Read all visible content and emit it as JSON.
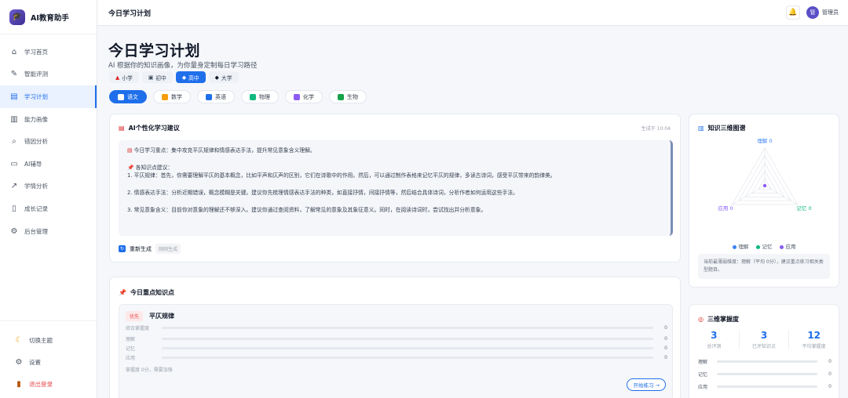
{
  "brand": {
    "name": "AI教育助手",
    "logo_icon": "graduation-cap-icon"
  },
  "sidebar": {
    "items": [
      {
        "label": "学习首页",
        "icon": "home-icon",
        "glyph": "⌂",
        "active": false
      },
      {
        "label": "智能评测",
        "icon": "edit-note-icon",
        "glyph": "✎",
        "active": false
      },
      {
        "label": "学习计划",
        "icon": "calendar-icon",
        "glyph": "▤",
        "active": true
      },
      {
        "label": "能力画像",
        "icon": "bar-chart-icon",
        "glyph": "▥",
        "active": false
      },
      {
        "label": "错因分析",
        "icon": "magnifier-icon",
        "glyph": "⌕",
        "active": false
      },
      {
        "label": "AI辅导",
        "icon": "chat-icon",
        "glyph": "▭",
        "active": false
      },
      {
        "label": "学情分析",
        "icon": "trend-chart-icon",
        "glyph": "↗",
        "active": false
      },
      {
        "label": "成长记录",
        "icon": "notebook-icon",
        "glyph": "▯",
        "active": false
      },
      {
        "label": "后台管理",
        "icon": "gear-icon",
        "glyph": "⚙",
        "active": false
      }
    ],
    "bottom": [
      {
        "label": "切换主题",
        "icon": "moon-icon",
        "glyph": "☾"
      },
      {
        "label": "设置",
        "icon": "gear-icon",
        "glyph": "⚙"
      },
      {
        "label": "退出登录",
        "icon": "door-icon",
        "glyph": "▮"
      }
    ]
  },
  "topbar": {
    "title": "今日学习计划",
    "user_name": "管理员",
    "avatar_text": "管"
  },
  "header": {
    "title": "今日学习计划",
    "subtitle": "AI 根据你的知识画像，为你量身定制每日学习路径",
    "levels": [
      {
        "label": "小学",
        "glyph": "▲",
        "active": false
      },
      {
        "label": "初中",
        "glyph": "▣",
        "active": false
      },
      {
        "label": "高中",
        "glyph": "◆",
        "active": true
      },
      {
        "label": "大学",
        "glyph": "◆",
        "active": false
      }
    ],
    "subjects": [
      {
        "label": "语文",
        "color": "#ffffff",
        "active": true
      },
      {
        "label": "数学",
        "color": "#f59e0b",
        "active": false
      },
      {
        "label": "英语",
        "color": "#1f6feb",
        "active": false
      },
      {
        "label": "物理",
        "color": "#10b981",
        "active": false
      },
      {
        "label": "化学",
        "color": "#8b5cf6",
        "active": false
      },
      {
        "label": "生物",
        "color": "#16a34a",
        "active": false
      }
    ]
  },
  "ai_card": {
    "title": "AI个性化学习建议",
    "generated_at": "生成于 10:04",
    "focus": "今日学习重点：集中攻克平仄规律和情感表达手法，提升常见意象含义理解。",
    "tips_title": "各知识点建议：",
    "tip_1": "1. 平仄规律：首先，你需要理解平仄的基本概念，比如平声和仄声的区别，它们在诗歌中的作用。然后，可以通过制作表格来记忆平仄的规律，多读古诗词，感受平仄带来的韵律美。",
    "tip_2": "2. 情感表达手法：分析近期错误，概念模糊是关键。建议你先梳理情感表达手法的种类，如直接抒情，间接抒情等，然后结合具体诗词，分析作者如何运用这些手法。",
    "tip_3": "3. 常见意象含义：目前你对意象的理解还不够深入。建议你通过查阅资料，了解常见的意象及其象征意义。同时，在阅读诗词时，尝试找出并分析意象。",
    "regen_label": "重新生成",
    "regen_tag": "刚刚生成"
  },
  "kp_card": {
    "title": "今日重点知识点",
    "priority": "优先",
    "name": "平仄规律",
    "rows": [
      {
        "label": "综合掌握度",
        "value": 0
      },
      {
        "label": "理解",
        "value": 0
      },
      {
        "label": "记忆",
        "value": 0
      },
      {
        "label": "应用",
        "value": 0
      }
    ],
    "note": "掌握度 0分，需要加强",
    "practice_label": "开始练习 →"
  },
  "radar_card": {
    "title": "知识三维图谱",
    "axis_top": "理解 0",
    "axis_left": "应用 0",
    "axis_right": "记忆 0",
    "legend": [
      {
        "label": "理解",
        "color": "#3b82f6"
      },
      {
        "label": "记忆",
        "color": "#10b981"
      },
      {
        "label": "应用",
        "color": "#8b5cf6"
      }
    ],
    "note": "当前最薄弱维度：理解（平均 0分），建议重点练习相关类型题目。"
  },
  "chart_data": {
    "type": "radar",
    "categories": [
      "理解",
      "记忆",
      "应用"
    ],
    "values": [
      0,
      0,
      0
    ],
    "grid": true
  },
  "mastery_card": {
    "title": "三维掌握度",
    "stats": [
      {
        "value": "3",
        "label": "总评测"
      },
      {
        "value": "3",
        "label": "已评知识点"
      },
      {
        "value": "12",
        "label": "平均掌握度"
      }
    ],
    "rows": [
      {
        "label": "理解",
        "value": 0
      },
      {
        "label": "记忆",
        "value": 0
      },
      {
        "label": "应用",
        "value": 0
      }
    ]
  }
}
